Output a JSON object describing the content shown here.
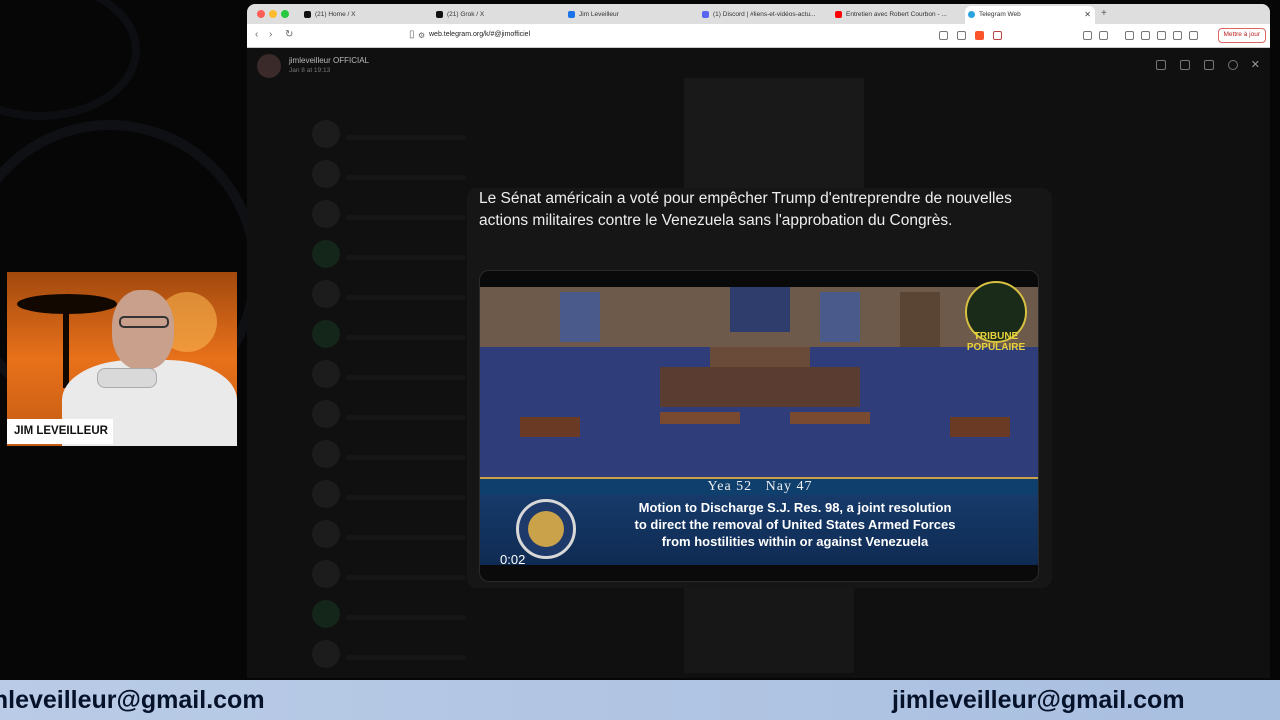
{
  "browser": {
    "tabs": [
      {
        "label": "(21) Home / X",
        "icon": "x-icon"
      },
      {
        "label": "(21) Grok / X",
        "icon": "x-icon"
      },
      {
        "label": "Jim Leveilleur",
        "icon": "mail-icon"
      },
      {
        "label": "(1) Discord | #liens-et-vidéos-actu...",
        "icon": "discord-icon"
      },
      {
        "label": "Entretien avec Robert Courbon - ...",
        "icon": "youtube-icon"
      },
      {
        "label": "Telegram Web",
        "icon": "telegram-icon"
      }
    ],
    "url": "web.telegram.org/k/#@jimofficiel",
    "update_button": "Mettre à jour"
  },
  "telegram": {
    "channel_name": "jimleveilleur OFFICIAL",
    "post_date": "Jan 8 at 19:13",
    "post_text": "Le Sénat américain a voté pour empêcher Trump d'entreprendre de nouvelles actions militaires contre le Venezuela sans l'approbation du Congrès.",
    "video": {
      "vote_text": "Yea 52   Nay 47",
      "caption_line1": "Motion to Discharge S.J. Res. 98, a joint resolution",
      "caption_line2": "to direct the removal of United States Armed Forces",
      "caption_line3": "from hostilities within or against Venezuela",
      "watermark_line1": "TRIBUNE",
      "watermark_line2": "POPULAIRE",
      "timestamp": "0:02"
    }
  },
  "webcam": {
    "name_label": "JIM LEVEILLEUR"
  },
  "banner": {
    "email_left": "jimleveilleur@gmail.com",
    "email_right": "jimleveilleur@gmail.com"
  }
}
